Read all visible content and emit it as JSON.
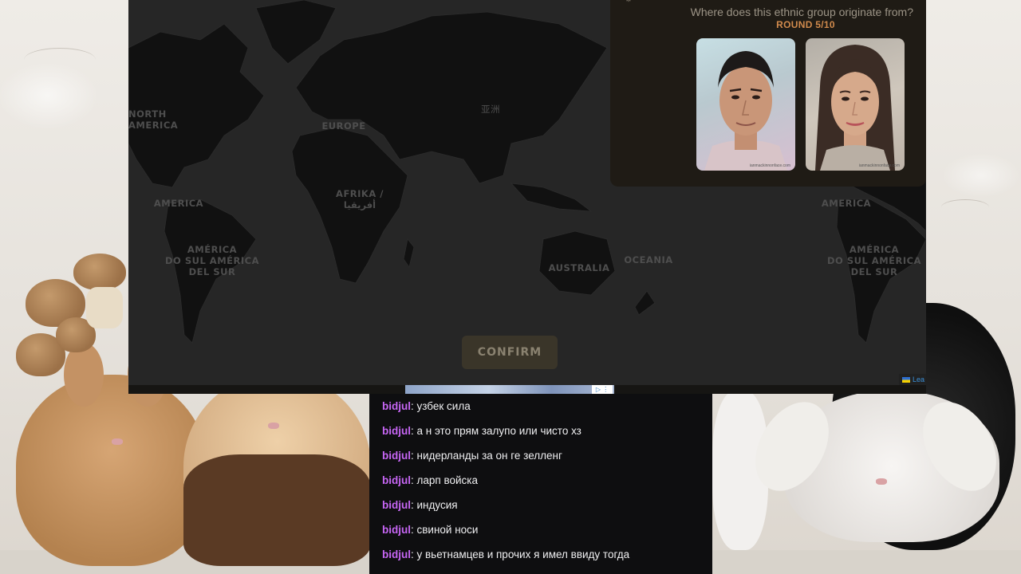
{
  "game": {
    "question": "Where does this ethnic group originate from?",
    "round": "ROUND 5/10",
    "confirm_label": "CONFIRM",
    "attribution": "Lea",
    "map_labels": {
      "north_america": "NORTH\nAMERICA",
      "europe": "EUROPE",
      "asia": "亚洲",
      "africa": "AFRIKA /\nأفريقيا",
      "america_left": "AMERICA",
      "america_right": "AMERICA",
      "south_america_left": "AMÉRICA\nDO SUL AMÉRICA\nDEL SUR",
      "south_america_right": "AMÉRICA\nDO SUL AMÉRICA\nDEL SUR",
      "australia": "AUSTRALIA",
      "oceania": "OCEANIA"
    },
    "faces": [
      {
        "label": "male-face",
        "watermark": "ianmackinnonface.com"
      },
      {
        "label": "female-face",
        "watermark": "ianmackinnonface.com"
      }
    ]
  },
  "chat": {
    "messages": [
      {
        "user": "bidjul",
        "text": ": узбек сила"
      },
      {
        "user": "bidjul",
        "text": ": а н это прям залупо или чисто хз"
      },
      {
        "user": "bidjul",
        "text": ": нидерланды за он ге зелленг"
      },
      {
        "user": "bidjul",
        "text": ": ларп войска"
      },
      {
        "user": "bidjul",
        "text": ": индусия"
      },
      {
        "user": "bidjul",
        "text": ": свиной носи"
      },
      {
        "user": "bidjul",
        "text": ": у вьетнамцев и прочих я имел ввиду тогда"
      }
    ]
  },
  "colors": {
    "accent_round": "#d08a4c",
    "chat_username": "#c766f5",
    "map_background": "#262626",
    "land": "#111111"
  }
}
